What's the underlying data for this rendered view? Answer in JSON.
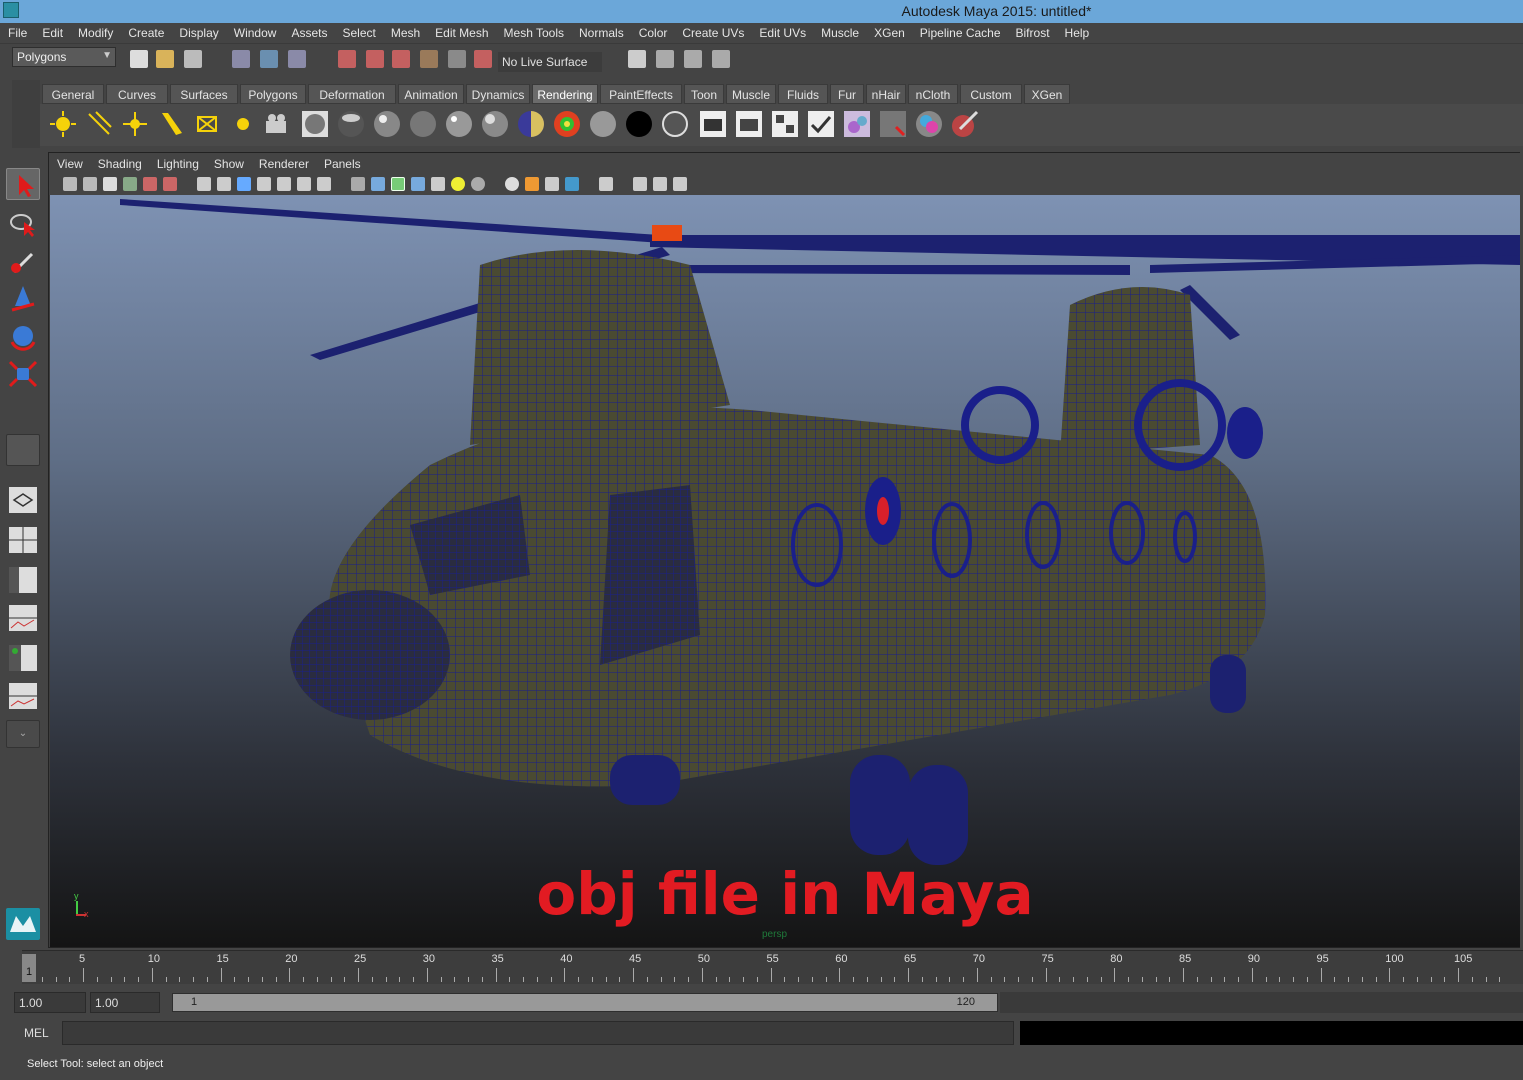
{
  "window": {
    "title": "Autodesk Maya 2015: untitled*"
  },
  "menubar": {
    "items": [
      "File",
      "Edit",
      "Modify",
      "Create",
      "Display",
      "Window",
      "Assets",
      "Select",
      "Mesh",
      "Edit Mesh",
      "Mesh Tools",
      "Normals",
      "Color",
      "Create UVs",
      "Edit UVs",
      "Muscle",
      "XGen",
      "Pipeline Cache",
      "Bifrost",
      "Help"
    ]
  },
  "statusline": {
    "menuset": "Polygons",
    "live_surface": "No Live Surface"
  },
  "shelf": {
    "tabs": [
      "General",
      "Curves",
      "Surfaces",
      "Polygons",
      "Deformation",
      "Animation",
      "Dynamics",
      "Rendering",
      "PaintEffects",
      "Toon",
      "Muscle",
      "Fluids",
      "Fur",
      "nHair",
      "nCloth",
      "Custom",
      "XGen"
    ],
    "active_tab": "Rendering"
  },
  "panel": {
    "menus": [
      "View",
      "Shading",
      "Lighting",
      "Show",
      "Renderer",
      "Panels"
    ],
    "camera": "persp"
  },
  "viewport": {
    "overlay_text": "obj file in Maya",
    "axis_y": "y",
    "axis_x": "x"
  },
  "timeline": {
    "labels": [
      "5",
      "10",
      "15",
      "20",
      "25",
      "30",
      "35",
      "40",
      "45",
      "50",
      "55",
      "60",
      "65",
      "70",
      "75",
      "80",
      "85",
      "90",
      "95",
      "100",
      "105"
    ],
    "current_frame": "1"
  },
  "range": {
    "start_field": "1.00",
    "playback_start": "1.00",
    "slider_start": "1",
    "slider_end": "120"
  },
  "command": {
    "mel_label": "MEL"
  },
  "helpline": {
    "text": "Select Tool: select an object"
  },
  "colors": {
    "title_bar": "#6ba7d9",
    "overlay_text": "#e21b22",
    "wireframe": "#1a1f8a",
    "hull": "#4a4a32"
  }
}
